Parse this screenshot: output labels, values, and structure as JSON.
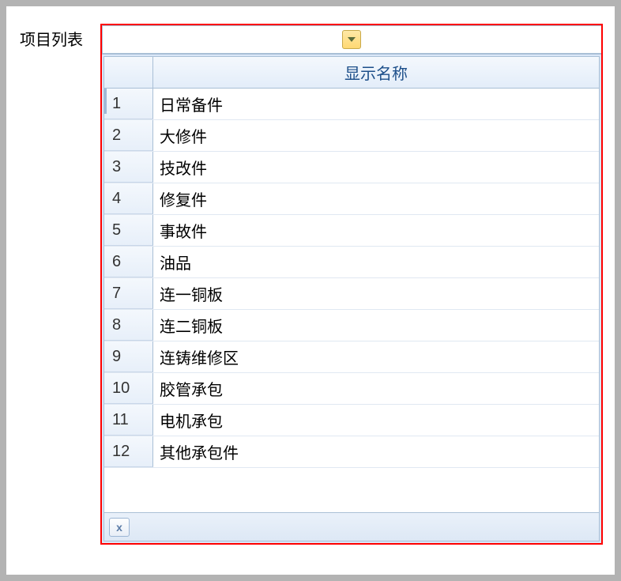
{
  "field_label": "项目列表",
  "dropdown": {
    "value": "",
    "placeholder": ""
  },
  "grid": {
    "header": "显示名称",
    "rows": [
      {
        "num": "1",
        "name": "日常备件"
      },
      {
        "num": "2",
        "name": "大修件"
      },
      {
        "num": "3",
        "name": "技改件"
      },
      {
        "num": "4",
        "name": "修复件"
      },
      {
        "num": "5",
        "name": "事故件"
      },
      {
        "num": "6",
        "name": "油品"
      },
      {
        "num": "7",
        "name": "连一铜板"
      },
      {
        "num": "8",
        "name": "连二铜板"
      },
      {
        "num": "9",
        "name": "连铸维修区"
      },
      {
        "num": "10",
        "name": "胶管承包"
      },
      {
        "num": "11",
        "name": "电机承包"
      },
      {
        "num": "12",
        "name": "其他承包件"
      }
    ],
    "clear_label": "x"
  }
}
